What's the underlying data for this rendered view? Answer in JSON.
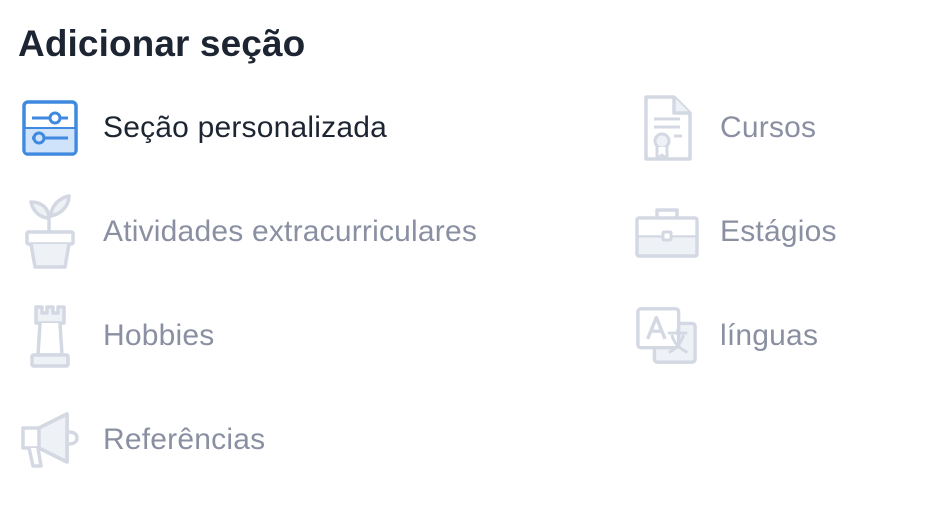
{
  "header": {
    "title": "Adicionar seção"
  },
  "colors": {
    "heading": "#1e2532",
    "muted_text": "#8a90a2",
    "muted_icon": "#d3d8e3",
    "accent": "#3f8ae0",
    "accent_fill": "#cfe3fb"
  },
  "sections": [
    {
      "label": "Seção personalizada",
      "icon": "sliders-icon",
      "active": true
    },
    {
      "label": "Cursos",
      "icon": "certificate-icon",
      "active": false
    },
    {
      "label": "Atividades extracurriculares",
      "icon": "potted-plant-icon",
      "active": false
    },
    {
      "label": "Estágios",
      "icon": "briefcase-icon",
      "active": false
    },
    {
      "label": "Hobbies",
      "icon": "chess-rook-icon",
      "active": false
    },
    {
      "label": "línguas",
      "icon": "translate-icon",
      "active": false
    },
    {
      "label": "Referências",
      "icon": "megaphone-icon",
      "active": false
    }
  ]
}
